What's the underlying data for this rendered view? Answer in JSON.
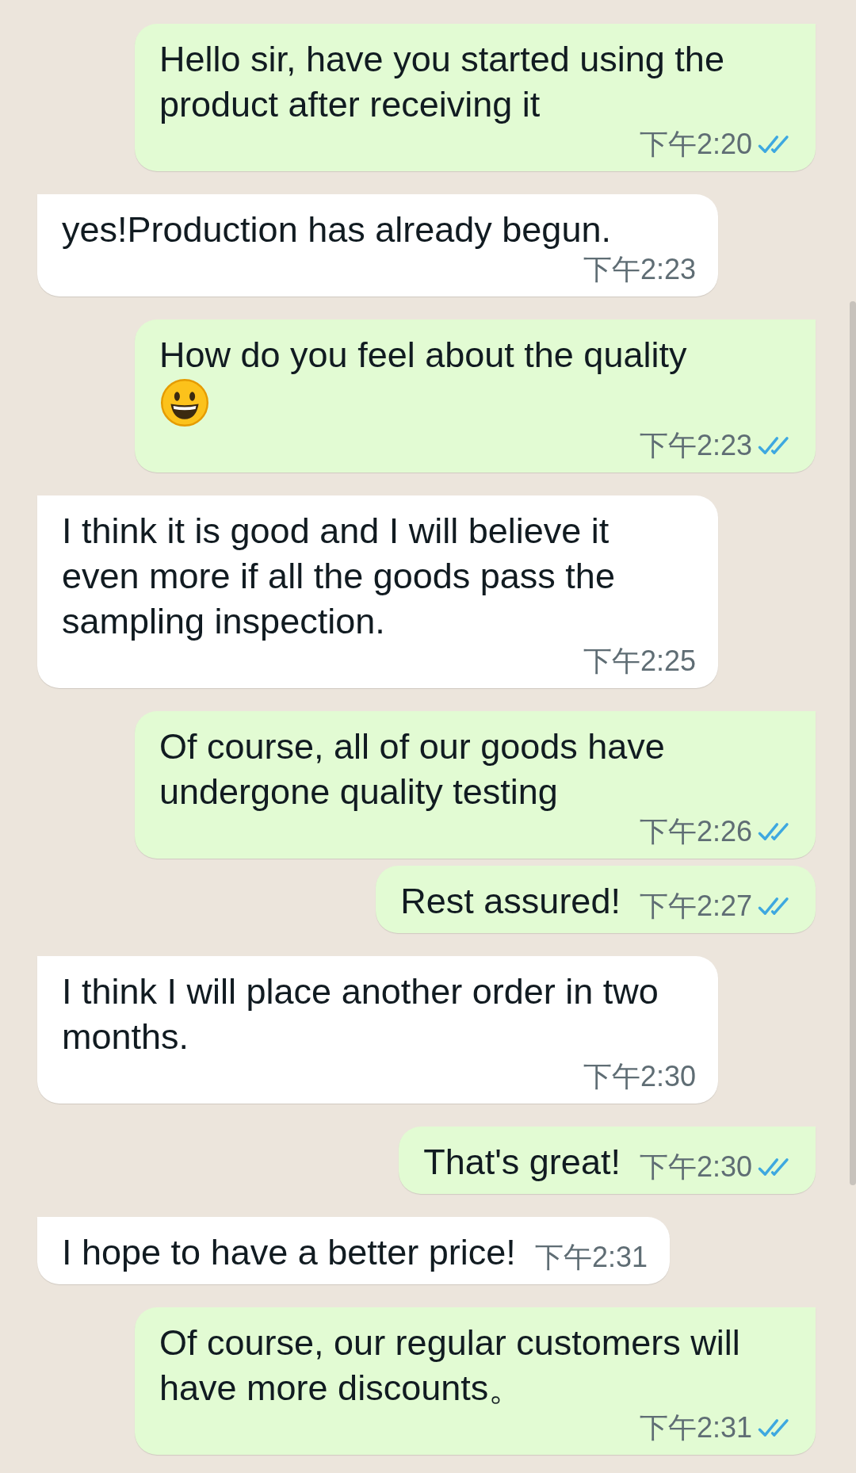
{
  "messages": [
    {
      "kind": "outgoing",
      "tail": true,
      "text": "Hello sir, have you started using the product after receiving it",
      "time": "下午2:20",
      "read": true
    },
    {
      "kind": "incoming",
      "tail": true,
      "text": "yes!Production has already begun.",
      "time": "下午2:23"
    },
    {
      "kind": "outgoing",
      "tail": true,
      "text": "How do you feel about the quality",
      "icons": [
        {
          "kind": "smiley"
        }
      ],
      "time": "下午2:23",
      "read": true
    },
    {
      "kind": "incoming",
      "tail": true,
      "text": "I think it is good and I will believe it even more if all the goods pass the sampling inspection.",
      "time": "下午2:25"
    },
    {
      "kind": "outgoing",
      "tail": true,
      "text": "Of course, all of our goods have undergone quality testing",
      "time": "下午2:26",
      "read": true
    },
    {
      "kind": "outgoing",
      "tail": false,
      "text": "Rest assured!",
      "time": "下午2:27",
      "read": true
    },
    {
      "kind": "incoming",
      "tail": true,
      "text": "I think I will place another order in two months.",
      "time": "下午2:30"
    },
    {
      "kind": "outgoing",
      "tail": true,
      "text": "That's great!",
      "time": "下午2:30",
      "read": true
    },
    {
      "kind": "incoming",
      "tail": true,
      "text": "I hope to have a better price!",
      "time": "下午2:31"
    },
    {
      "kind": "outgoing",
      "tail": true,
      "text": "Of course, our regular customers will have more discounts。",
      "time": "下午2:31",
      "read": true
    }
  ]
}
